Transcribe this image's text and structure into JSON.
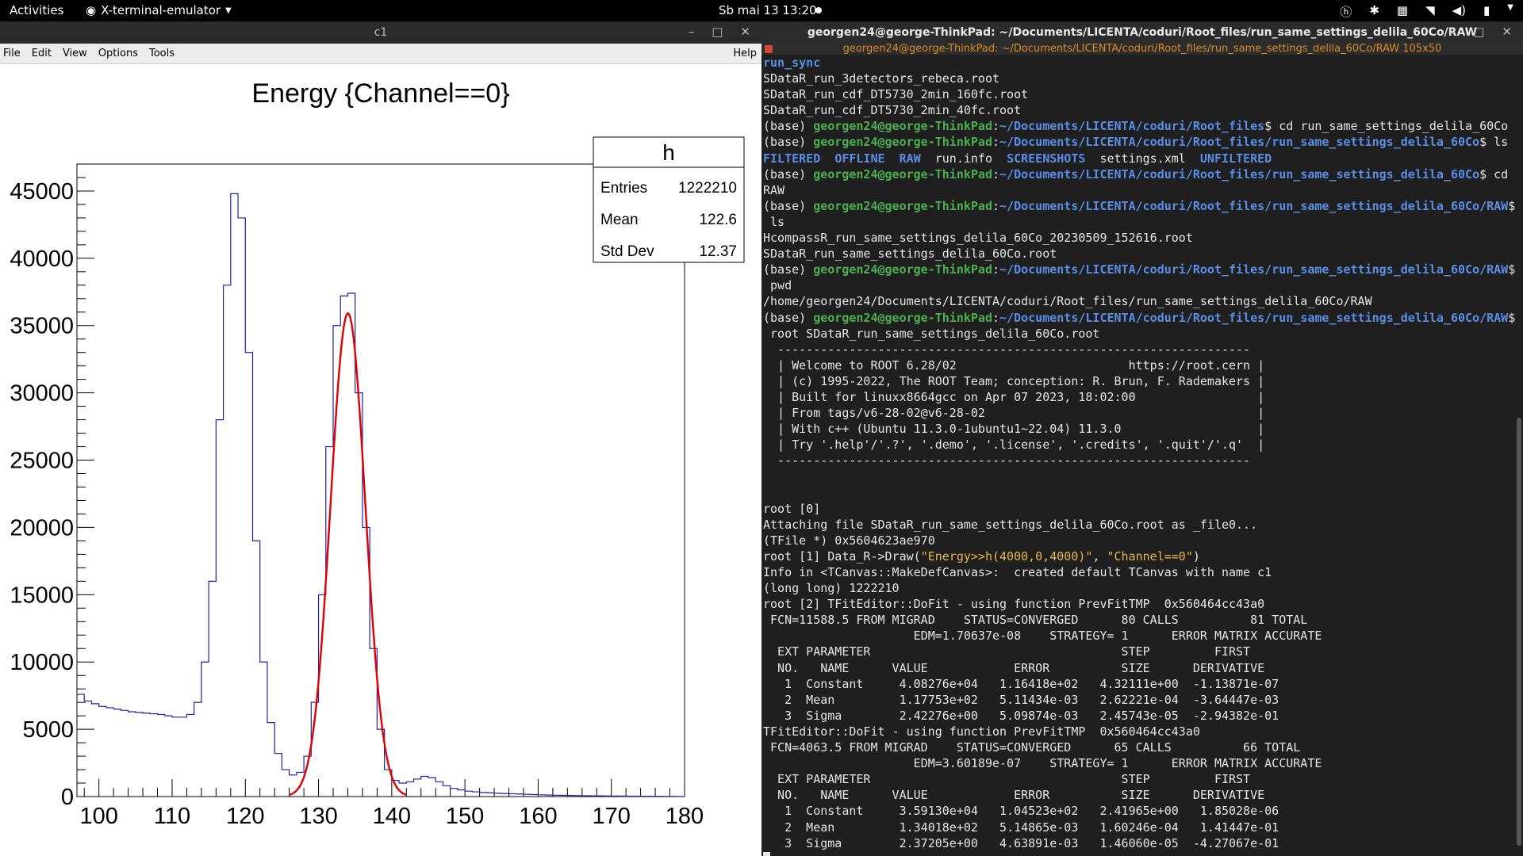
{
  "topbar": {
    "activities": "Activities",
    "app_name": "X-terminal-emulator",
    "clock": "Sb mai 13  13:20"
  },
  "root_window": {
    "title": "c1",
    "menu": [
      "File",
      "Edit",
      "View",
      "Options",
      "Tools"
    ],
    "help": "Help"
  },
  "stats": {
    "name": "h",
    "rows": [
      {
        "label": "Entries",
        "value": "1222210"
      },
      {
        "label": "Mean",
        "value": "122.6"
      },
      {
        "label": "Std Dev",
        "value": "12.37"
      }
    ]
  },
  "chart_data": {
    "type": "line",
    "title": "Energy {Channel==0}",
    "xlim": [
      97,
      180
    ],
    "ylim": [
      0,
      47000
    ],
    "x_ticks": [
      100,
      110,
      120,
      130,
      140,
      150,
      160,
      170,
      180
    ],
    "y_ticks": [
      0,
      5000,
      10000,
      15000,
      20000,
      25000,
      30000,
      35000,
      40000,
      45000
    ],
    "histogram": {
      "x": [
        97,
        98,
        99,
        100,
        101,
        102,
        103,
        104,
        105,
        106,
        107,
        108,
        109,
        110,
        111,
        112,
        113,
        114,
        115,
        116,
        117,
        118,
        119,
        120,
        121,
        122,
        123,
        124,
        125,
        126,
        127,
        128,
        129,
        130,
        131,
        132,
        133,
        134,
        135,
        136,
        137,
        138,
        139,
        140,
        141,
        142,
        143,
        144,
        145,
        146,
        147,
        148,
        149,
        150,
        151,
        152,
        153,
        154,
        155,
        156,
        157,
        158,
        159,
        160,
        161,
        162,
        163,
        164,
        165,
        166,
        167,
        168,
        169,
        170,
        171,
        172,
        173,
        174,
        175,
        176,
        177,
        178,
        179
      ],
      "y": [
        7600,
        7100,
        6900,
        6700,
        6600,
        6500,
        6400,
        6300,
        6250,
        6200,
        6150,
        6100,
        6000,
        5900,
        5900,
        6100,
        7000,
        10000,
        16000,
        28000,
        38000,
        44800,
        43000,
        33000,
        19000,
        10000,
        5500,
        3200,
        2000,
        1600,
        1800,
        3000,
        7000,
        15000,
        26000,
        35000,
        37200,
        37400,
        30000,
        20000,
        11000,
        5000,
        2000,
        1200,
        1000,
        1100,
        1300,
        1500,
        1400,
        1100,
        800,
        600,
        500,
        400,
        350,
        300,
        280,
        250,
        230,
        210,
        190,
        170,
        150,
        130,
        110,
        100,
        90,
        80,
        70,
        60,
        55,
        50,
        45,
        40,
        35,
        30,
        28,
        25,
        22,
        20,
        18,
        15,
        12
      ]
    },
    "fit": {
      "function": "gaus",
      "constant": 35913,
      "mean": 134.018,
      "sigma": 2.37205,
      "range": [
        126,
        142
      ]
    },
    "colors": {
      "histogram": "#1f1fa8",
      "fit": "#e00000"
    }
  },
  "terminal": {
    "title": "georgen24@george-ThinkPad: ~/Documents/LICENTA/coduri/Root_files/run_same_settings_delila_60Co/RAW",
    "subtitle": "georgen24@george-ThinkPad: ~/Documents/LICENTA/coduri/Root_files/run_same_settings_delila_60Co/RAW 105x50",
    "lines": [
      [
        {
          "t": "run_sync",
          "c": "b"
        }
      ],
      [
        {
          "t": "SDataR_run_3detectors_rebeca.root"
        }
      ],
      [
        {
          "t": "SDataR_run_cdf_DT5730_2min_160fc.root"
        }
      ],
      [
        {
          "t": "SDataR_run_cdf_DT5730_2min_40fc.root"
        }
      ],
      [
        {
          "t": "(base) "
        },
        {
          "t": "georgen24@george-ThinkPad",
          "c": "g"
        },
        {
          "t": ":"
        },
        {
          "t": "~/Documents/LICENTA/coduri/Root_files",
          "c": "b"
        },
        {
          "t": "$ cd run_same_settings_delila_60Co"
        }
      ],
      [
        {
          "t": "(base) "
        },
        {
          "t": "georgen24@george-ThinkPad",
          "c": "g"
        },
        {
          "t": ":"
        },
        {
          "t": "~/Documents/LICENTA/coduri/Root_files/run_same_settings_delila_60Co",
          "c": "b"
        },
        {
          "t": "$ ls"
        }
      ],
      [
        {
          "t": "FILTERED",
          "c": "b"
        },
        {
          "t": "  "
        },
        {
          "t": "OFFLINE",
          "c": "b"
        },
        {
          "t": "  "
        },
        {
          "t": "RAW",
          "c": "b"
        },
        {
          "t": "  run.info  "
        },
        {
          "t": "SCREENSHOTS",
          "c": "b"
        },
        {
          "t": "  settings.xml  "
        },
        {
          "t": "UNFILTERED",
          "c": "b"
        }
      ],
      [
        {
          "t": "(base) "
        },
        {
          "t": "georgen24@george-ThinkPad",
          "c": "g"
        },
        {
          "t": ":"
        },
        {
          "t": "~/Documents/LICENTA/coduri/Root_files/run_same_settings_delila_60Co",
          "c": "b"
        },
        {
          "t": "$ cd"
        }
      ],
      [
        {
          "t": "RAW"
        }
      ],
      [
        {
          "t": "(base) "
        },
        {
          "t": "georgen24@george-ThinkPad",
          "c": "g"
        },
        {
          "t": ":"
        },
        {
          "t": "~/Documents/LICENTA/coduri/Root_files/run_same_settings_delila_60Co/RAW",
          "c": "b"
        },
        {
          "t": "$"
        }
      ],
      [
        {
          "t": " ls"
        }
      ],
      [
        {
          "t": "HcompassR_run_same_settings_delila_60Co_20230509_152616.root"
        }
      ],
      [
        {
          "t": "SDataR_run_same_settings_delila_60Co.root"
        }
      ],
      [
        {
          "t": "(base) "
        },
        {
          "t": "georgen24@george-ThinkPad",
          "c": "g"
        },
        {
          "t": ":"
        },
        {
          "t": "~/Documents/LICENTA/coduri/Root_files/run_same_settings_delila_60Co/RAW",
          "c": "b"
        },
        {
          "t": "$"
        }
      ],
      [
        {
          "t": " pwd"
        }
      ],
      [
        {
          "t": "/home/georgen24/Documents/LICENTA/coduri/Root_files/run_same_settings_delila_60Co/RAW"
        }
      ],
      [
        {
          "t": "(base) "
        },
        {
          "t": "georgen24@george-ThinkPad",
          "c": "g"
        },
        {
          "t": ":"
        },
        {
          "t": "~/Documents/LICENTA/coduri/Root_files/run_same_settings_delila_60Co/RAW",
          "c": "b"
        },
        {
          "t": "$"
        }
      ],
      [
        {
          "t": " root SDataR_run_same_settings_delila_60Co.root"
        }
      ],
      [
        {
          "t": "  ------------------------------------------------------------------"
        }
      ],
      [
        {
          "t": "  | Welcome to ROOT 6.28/02                        https://root.cern |"
        }
      ],
      [
        {
          "t": "  | (c) 1995-2022, The ROOT Team; conception: R. Brun, F. Rademakers |"
        }
      ],
      [
        {
          "t": "  | Built for linuxx8664gcc on Apr 07 2023, 18:02:00                 |"
        }
      ],
      [
        {
          "t": "  | From tags/v6-28-02@v6-28-02                                      |"
        }
      ],
      [
        {
          "t": "  | With c++ (Ubuntu 11.3.0-1ubuntu1~22.04) 11.3.0                   |"
        }
      ],
      [
        {
          "t": "  | Try '.help'/'.?', '.demo', '.license', '.credits', '.quit'/'.q'  |"
        }
      ],
      [
        {
          "t": "  ------------------------------------------------------------------"
        }
      ],
      [
        {
          "t": ""
        }
      ],
      [
        {
          "t": ""
        }
      ],
      [
        {
          "t": "root [0]"
        }
      ],
      [
        {
          "t": "Attaching file SDataR_run_same_settings_delila_60Co.root as _file0..."
        }
      ],
      [
        {
          "t": "(TFile *) 0x5604623ae970"
        }
      ],
      [
        {
          "t": "root [1] Data_R->Draw("
        },
        {
          "t": "\"Energy>>h(4000,0,4000)\"",
          "c": "y"
        },
        {
          "t": ", "
        },
        {
          "t": "\"Channel==0\"",
          "c": "y"
        },
        {
          "t": ")"
        }
      ],
      [
        {
          "t": "Info in <TCanvas::MakeDefCanvas>:  created default TCanvas with name c1"
        }
      ],
      [
        {
          "t": "(long long) 1222210"
        }
      ],
      [
        {
          "t": "root [2] TFitEditor::DoFit - using function PrevFitTMP  0x560464cc43a0"
        }
      ],
      [
        {
          "t": " FCN=11588.5 FROM MIGRAD    STATUS=CONVERGED      80 CALLS          81 TOTAL"
        }
      ],
      [
        {
          "t": "                     EDM=1.70637e-08    STRATEGY= 1      ERROR MATRIX ACCURATE"
        }
      ],
      [
        {
          "t": "  EXT PARAMETER                                   STEP         FIRST"
        }
      ],
      [
        {
          "t": "  NO.   NAME      VALUE            ERROR          SIZE      DERIVATIVE"
        }
      ],
      [
        {
          "t": "   1  Constant     4.08276e+04   1.16418e+02   4.32111e+00  -1.13871e-07"
        }
      ],
      [
        {
          "t": "   2  Mean         1.17753e+02   5.11434e-03   2.62221e-04  -3.64447e-03"
        }
      ],
      [
        {
          "t": "   3  Sigma        2.42276e+00   5.09874e-03   2.45743e-05  -2.94382e-01"
        }
      ],
      [
        {
          "t": "TFitEditor::DoFit - using function PrevFitTMP  0x560464cc43a0"
        }
      ],
      [
        {
          "t": " FCN=4063.5 FROM MIGRAD    STATUS=CONVERGED      65 CALLS          66 TOTAL"
        }
      ],
      [
        {
          "t": "                     EDM=3.60189e-07    STRATEGY= 1      ERROR MATRIX ACCURATE"
        }
      ],
      [
        {
          "t": "  EXT PARAMETER                                   STEP         FIRST"
        }
      ],
      [
        {
          "t": "  NO.   NAME      VALUE            ERROR          SIZE      DERIVATIVE"
        }
      ],
      [
        {
          "t": "   1  Constant     3.59130e+04   1.04523e+02   2.41965e+00   1.85028e-06"
        }
      ],
      [
        {
          "t": "   2  Mean         1.34018e+02   5.14865e-03   1.60246e-04   1.41447e-01"
        }
      ],
      [
        {
          "t": "   3  Sigma        2.37205e+00   4.63891e-03   1.46060e-05  -4.27067e-01"
        }
      ]
    ]
  }
}
